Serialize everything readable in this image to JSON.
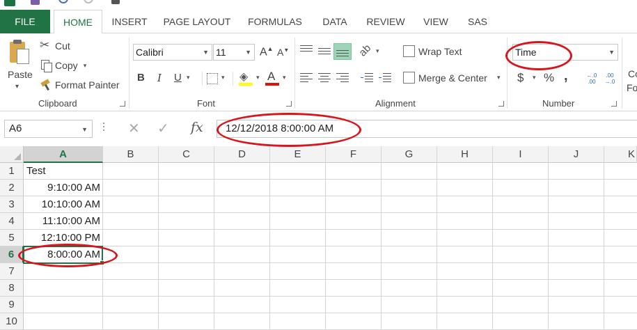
{
  "tabs": [
    "FILE",
    "HOME",
    "INSERT",
    "PAGE LAYOUT",
    "FORMULAS",
    "DATA",
    "REVIEW",
    "VIEW",
    "SAS"
  ],
  "clipboard": {
    "paste_label": "Paste",
    "cut_label": "Cut",
    "copy_label": "Copy",
    "format_painter_label": "Format Painter",
    "group_label": "Clipboard"
  },
  "font": {
    "family": "Calibri",
    "size": "11",
    "grow_label": "A",
    "shrink_label": "A",
    "bold_label": "B",
    "italic_label": "I",
    "underline_label": "U",
    "fill_label": "A",
    "font_color_label": "A",
    "group_label": "Font"
  },
  "alignment": {
    "wrap_text_label": "Wrap Text",
    "merge_center_label": "Merge & Center",
    "group_label": "Alignment"
  },
  "number": {
    "format_value": "Time",
    "currency_label": "$",
    "percent_label": "%",
    "comma_label": ",",
    "increase_decimal_label": "←.0 .00",
    "decrease_decimal_label": ".00 →.0",
    "group_label": "Number"
  },
  "styles": {
    "partial_label_1": "Co",
    "partial_label_2": "Fo"
  },
  "formula_bar": {
    "name_box": "A6",
    "cancel_icon": "✕",
    "enter_icon": "✓",
    "fx_label": "fx",
    "formula": "12/12/2018  8:00:00 AM"
  },
  "grid": {
    "columns": [
      "A",
      "B",
      "C",
      "D",
      "E",
      "F",
      "G",
      "H",
      "I",
      "J",
      "K"
    ],
    "rows": [
      "1",
      "2",
      "3",
      "4",
      "5",
      "6",
      "7",
      "8",
      "9",
      "10"
    ],
    "selected_column": "A",
    "selected_row": "6",
    "cells": {
      "A1": "Test",
      "A2": "9:10:00 AM",
      "A3": "10:10:00 AM",
      "A4": "11:10:00 AM",
      "A5": "12:10:00 PM",
      "A6": "8:00:00 AM"
    }
  },
  "colors": {
    "accent": "#217346",
    "annotation": "#d9151c"
  }
}
